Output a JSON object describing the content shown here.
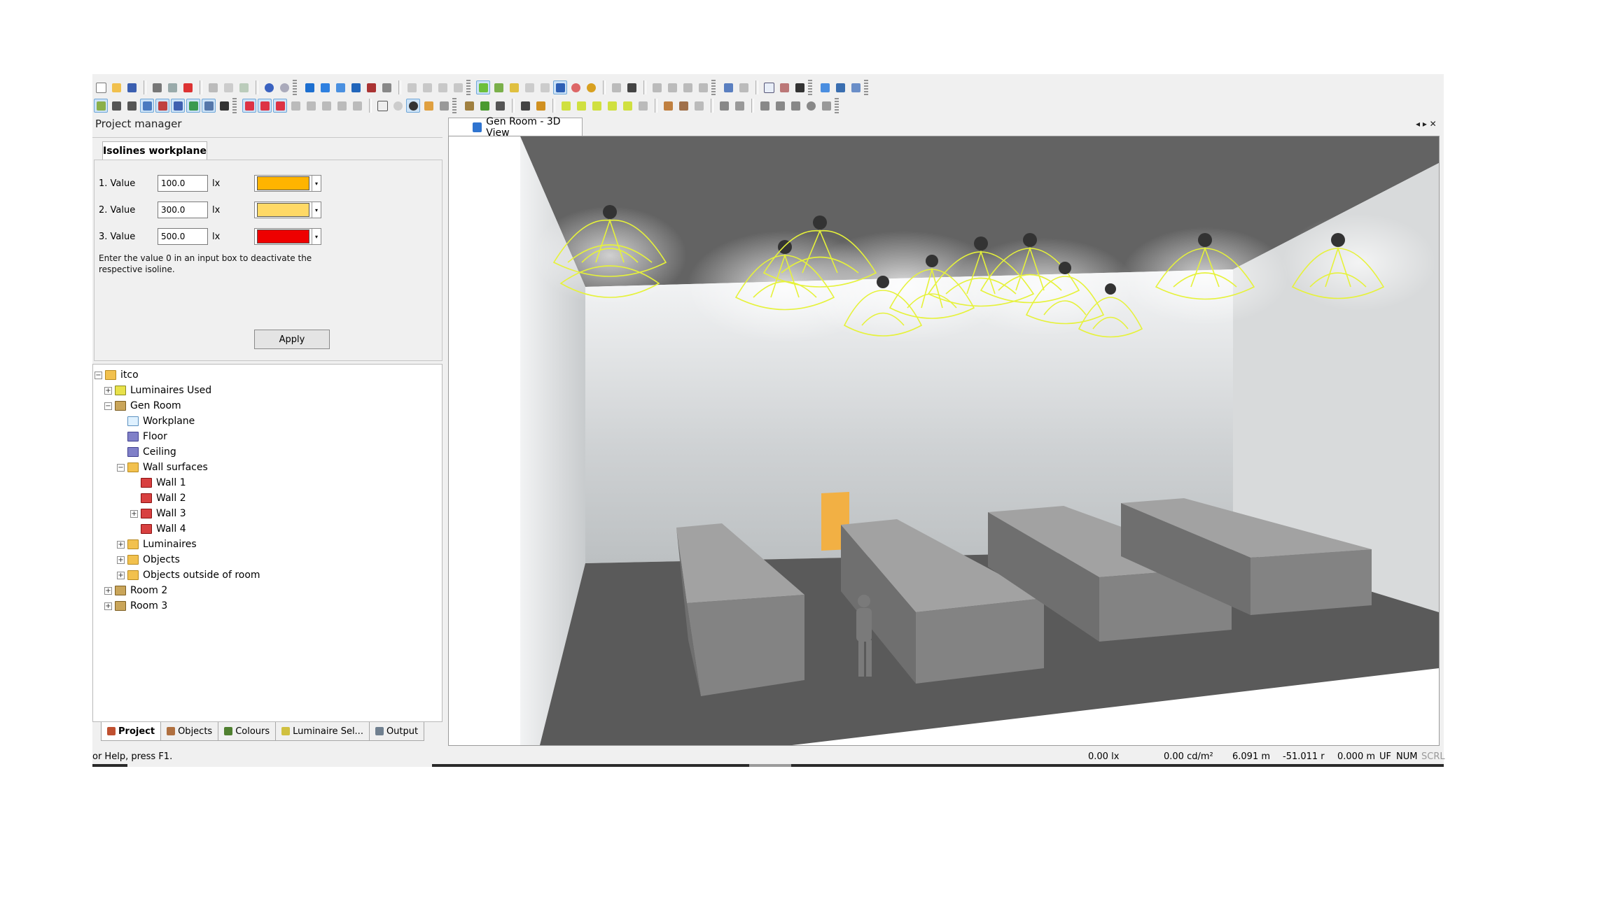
{
  "project_manager": {
    "title": "Project manager",
    "isolines_tab": "Isolines workplane",
    "values": [
      {
        "label": "1. Value",
        "value": "100.0",
        "unit": "lx",
        "color": "#ffb400"
      },
      {
        "label": "2. Value",
        "value": "300.0",
        "unit": "lx",
        "color": "#ffd966"
      },
      {
        "label": "3. Value",
        "value": "500.0",
        "unit": "lx",
        "color": "#ee0000"
      }
    ],
    "hint": "Enter the value 0 in an input box to deactivate the respective isoline.",
    "apply_label": "Apply"
  },
  "tree": {
    "items": [
      {
        "label": "itco",
        "expander": "−"
      },
      {
        "label": "Luminaires Used",
        "expander": "+"
      },
      {
        "label": "Gen Room",
        "expander": "−"
      },
      {
        "label": "Workplane",
        "expander": ""
      },
      {
        "label": "Floor",
        "expander": ""
      },
      {
        "label": "Ceiling",
        "expander": ""
      },
      {
        "label": "Wall surfaces",
        "expander": "−"
      },
      {
        "label": "Wall 1",
        "expander": ""
      },
      {
        "label": "Wall 2",
        "expander": ""
      },
      {
        "label": "Wall 3",
        "expander": "+"
      },
      {
        "label": "Wall 4",
        "expander": ""
      },
      {
        "label": "Luminaires",
        "expander": "+"
      },
      {
        "label": "Objects",
        "expander": "+"
      },
      {
        "label": "Objects outside of room",
        "expander": "+"
      },
      {
        "label": "Room 2",
        "expander": "+"
      },
      {
        "label": "Room 3",
        "expander": "+"
      }
    ]
  },
  "bottom_tabs": [
    {
      "label": "Project",
      "icon": "project-icon",
      "color": "#c05030"
    },
    {
      "label": "Objects",
      "icon": "objects-icon",
      "color": "#b07040"
    },
    {
      "label": "Colours",
      "icon": "colours-icon",
      "color": "#508030"
    },
    {
      "label": "Luminaire Sel...",
      "icon": "luminaire-icon",
      "color": "#d0c040"
    },
    {
      "label": "Output",
      "icon": "output-icon",
      "color": "#708090"
    }
  ],
  "view": {
    "tab_label": "Gen Room - 3D View",
    "controls": "◂ ▸ ✕"
  },
  "status": {
    "help": "or Help, press F1.",
    "illuminance": "0.00 lx",
    "luminance": "0.00 cd/m²",
    "x": "6.091 m",
    "y": "-51.011 r",
    "z": "0.000 m",
    "uf": "UF",
    "num": "NUM",
    "scrl": "SCRL"
  },
  "colors": {
    "luminaire": "#e6f23a",
    "wall": "#d2d5d7",
    "floor": "#5a5a5a",
    "ceiling": "#636363",
    "block": "#8a8a8a",
    "door": "#f2b044"
  }
}
